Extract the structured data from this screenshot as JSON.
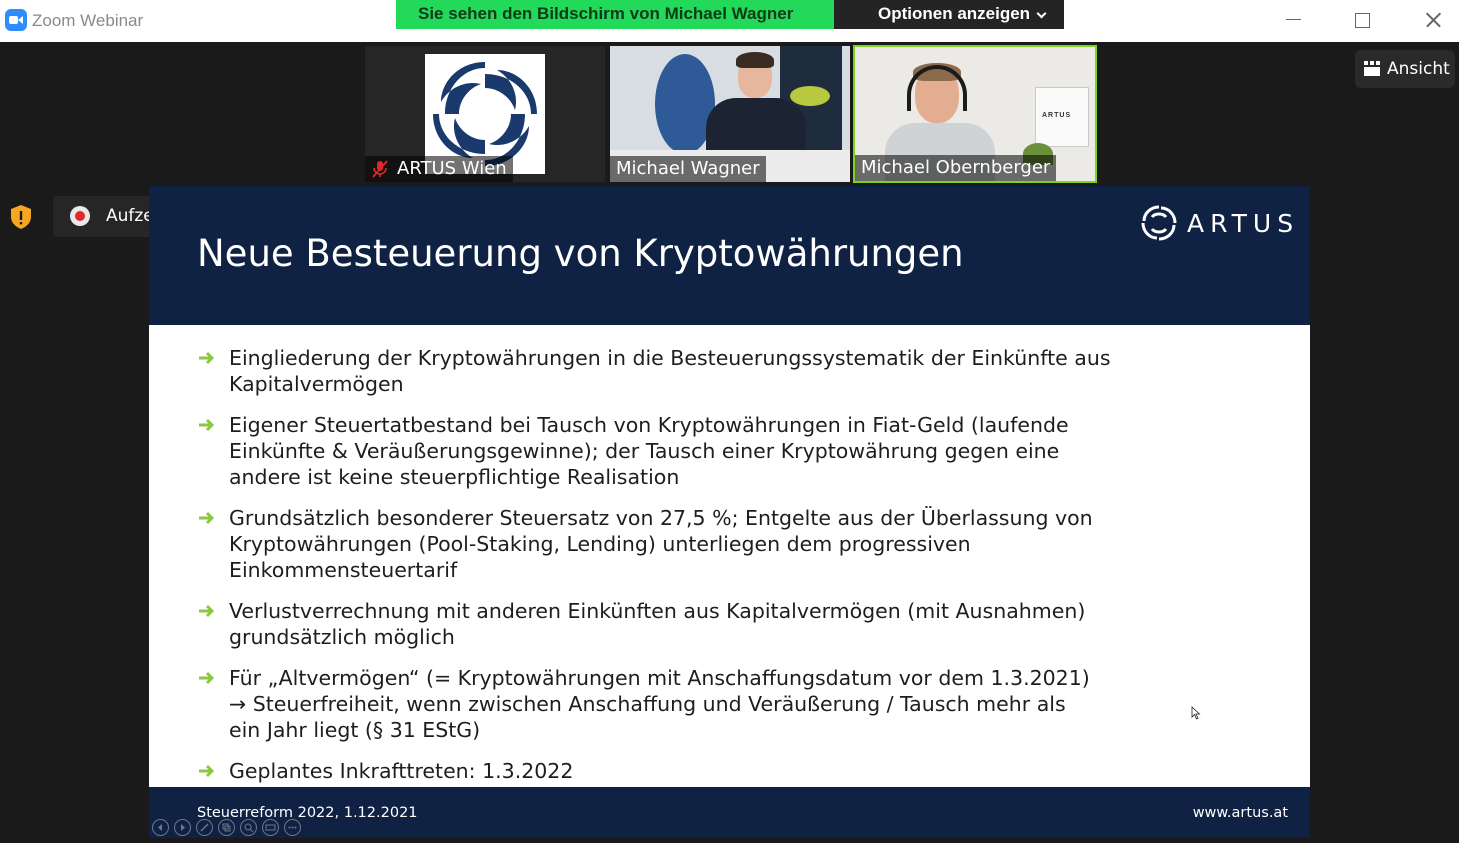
{
  "window": {
    "app_title": "Zoom Webinar",
    "share_banner": "Sie sehen den Bildschirm von Michael Wagner",
    "options_label": "Optionen anzeigen"
  },
  "participants": [
    {
      "name": "ARTUS Wien",
      "muted": true
    },
    {
      "name": "Michael Wagner",
      "muted": false
    },
    {
      "name": "Michael Obernberger",
      "muted": false,
      "active_speaker": true
    }
  ],
  "view_button": {
    "label": "Ansicht"
  },
  "recording": {
    "label": "Aufzeichnung läuft ..."
  },
  "slide": {
    "title": "Neue Besteuerung von Kryptowährungen",
    "logo_text": "ARTUS",
    "bullets": [
      {
        "lines": [
          "Eingliederung der Kryptowährungen in die Besteuerungssystematik der Einkünfte aus",
          "Kapitalvermögen"
        ]
      },
      {
        "lines": [
          "Eigener Steuertatbestand bei Tausch von Kryptowährungen in Fiat-Geld (laufende",
          "Einkünfte & Veräußerungsgewinne); der Tausch einer Kryptowährung gegen eine",
          "andere ist keine steuerpflichtige Realisation"
        ]
      },
      {
        "lines": [
          "Grundsätzlich besonderer Steuersatz von 27,5 %; Entgelte aus der Überlassung von",
          "Kryptowährungen (Pool-Staking, Lending) unterliegen dem progressiven",
          "Einkommensteuertarif"
        ]
      },
      {
        "lines": [
          "Verlustverrechnung mit anderen Einkünften aus Kapitalvermögen (mit Ausnahmen)",
          "grundsätzlich möglich"
        ]
      },
      {
        "lines": [
          "Für „Altvermögen“ (= Kryptowährungen mit Anschaffungsdatum vor dem 1.3.2021)",
          "→ Steuerfreiheit, wenn zwischen Anschaffung und Veräußerung / Tausch mehr als",
          "ein Jahr liegt (§ 31 EStG)"
        ]
      },
      {
        "lines": [
          "Geplantes Inkrafttreten: 1.3.2022"
        ]
      }
    ],
    "footer_left": "Steuerreform 2022, 1.12.2021",
    "footer_right": "www.artus.at"
  },
  "colors": {
    "share_banner_bg": "#23d959",
    "slide_navy": "#0f2243",
    "bullet_arrow": "#8dc63f",
    "active_speaker_border": "#7ed321",
    "recording_red": "#e02828",
    "security_shield": "#f5a623"
  },
  "icons": {
    "app": "zoom-camera-icon",
    "options": "chevron-down-icon",
    "muted": "mic-muted-icon",
    "view": "grid-view-icon",
    "security": "shield-icon",
    "recording": "record-icon",
    "pause": "pause-icon",
    "stop": "stop-icon",
    "bullet": "arrow-right-icon"
  }
}
